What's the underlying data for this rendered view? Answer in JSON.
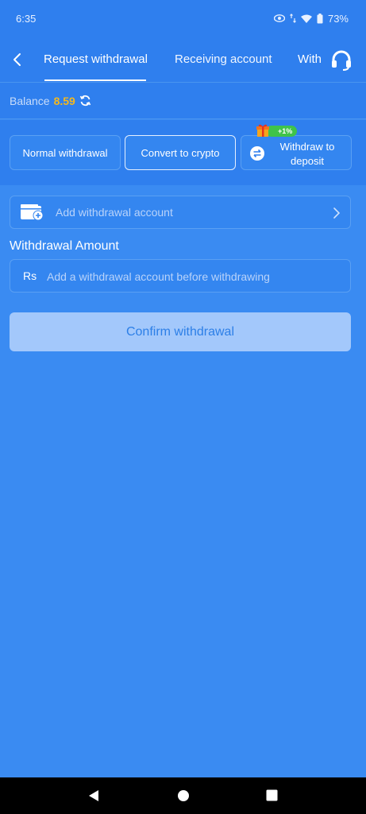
{
  "status_bar": {
    "time": "6:35",
    "battery": "73%"
  },
  "header": {
    "tabs": [
      {
        "label": "Request withdrawal"
      },
      {
        "label": "Receiving account"
      },
      {
        "label": "With"
      }
    ],
    "active_tab": 0
  },
  "balance": {
    "label": "Balance",
    "value": "8.59"
  },
  "methods": [
    {
      "label": "Normal withdrawal"
    },
    {
      "label": "Convert to crypto"
    },
    {
      "label": "Withdraw to deposit",
      "badge": "+1%"
    }
  ],
  "account": {
    "placeholder": "Add withdrawal account"
  },
  "amount": {
    "label": "Withdrawal Amount",
    "currency": "Rs",
    "placeholder": "Add a withdrawal account before withdrawing"
  },
  "confirm_button": {
    "label": "Confirm withdrawal"
  },
  "colors": {
    "background": "#3a8bf2",
    "header": "#2f7fee",
    "balance_value": "#f5b81c",
    "confirm_button": "#a3c8fb",
    "badge": "#3fc34a"
  }
}
